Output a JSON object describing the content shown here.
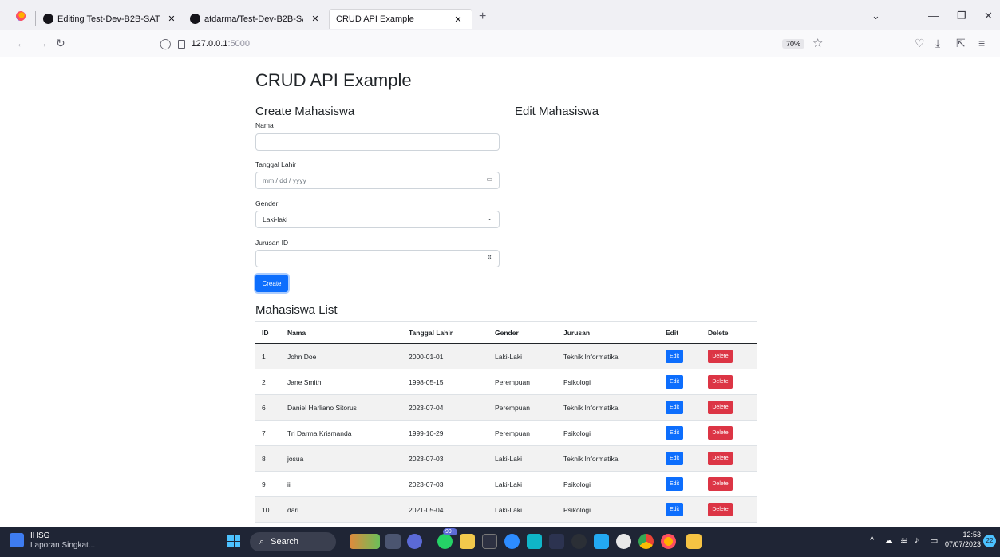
{
  "browser": {
    "tabs": [
      {
        "label": "Editing Test-Dev-B2B-SAT/REA",
        "active": false
      },
      {
        "label": "atdarma/Test-Dev-B2B-SAT",
        "active": false
      },
      {
        "label": "CRUD API Example",
        "active": true
      }
    ],
    "url_host": "127.0.0.1",
    "url_port": ":5000",
    "zoom": "70%"
  },
  "page": {
    "title": "CRUD API Example",
    "create_heading": "Create Mahasiswa",
    "edit_heading": "Edit Mahasiswa",
    "form": {
      "nama_label": "Nama",
      "nama_value": "",
      "tanggal_label": "Tanggal Lahir",
      "tanggal_placeholder": "mm / dd / yyyy",
      "gender_label": "Gender",
      "gender_selected": "Laki-laki",
      "jurusan_label": "Jurusan ID",
      "jurusan_value": "",
      "create_button": "Create"
    },
    "list_heading": "Mahasiswa List",
    "table": {
      "headers": [
        "ID",
        "Nama",
        "Tanggal Lahir",
        "Gender",
        "Jurusan",
        "Edit",
        "Delete"
      ],
      "edit_label": "Edit",
      "delete_label": "Delete",
      "rows": [
        {
          "id": "1",
          "nama": "John Doe",
          "tanggal": "2000-01-01",
          "gender": "Laki-Laki",
          "jurusan": "Teknik Informatika"
        },
        {
          "id": "2",
          "nama": "Jane Smith",
          "tanggal": "1998-05-15",
          "gender": "Perempuan",
          "jurusan": "Psikologi"
        },
        {
          "id": "6",
          "nama": "Daniel Harliano Sitorus",
          "tanggal": "2023-07-04",
          "gender": "Perempuan",
          "jurusan": "Teknik Informatika"
        },
        {
          "id": "7",
          "nama": "Tri Darma Krismanda",
          "tanggal": "1999-10-29",
          "gender": "Perempuan",
          "jurusan": "Psikologi"
        },
        {
          "id": "8",
          "nama": "josua",
          "tanggal": "2023-07-03",
          "gender": "Laki-Laki",
          "jurusan": "Teknik Informatika"
        },
        {
          "id": "9",
          "nama": "ii",
          "tanggal": "2023-07-03",
          "gender": "Laki-Laki",
          "jurusan": "Psikologi"
        },
        {
          "id": "10",
          "nama": "dari",
          "tanggal": "2021-05-04",
          "gender": "Laki-Laki",
          "jurusan": "Psikologi"
        }
      ]
    }
  },
  "taskbar": {
    "news_title": "IHSG",
    "news_sub": "Laporan Singkat...",
    "search_label": "Search",
    "badge": "99+",
    "time": "12:53",
    "date": "07/07/2023",
    "notifications": "22"
  },
  "colors": {
    "primary": "#0d6efd",
    "danger": "#dc3545",
    "taskbar": "#1f2535"
  }
}
